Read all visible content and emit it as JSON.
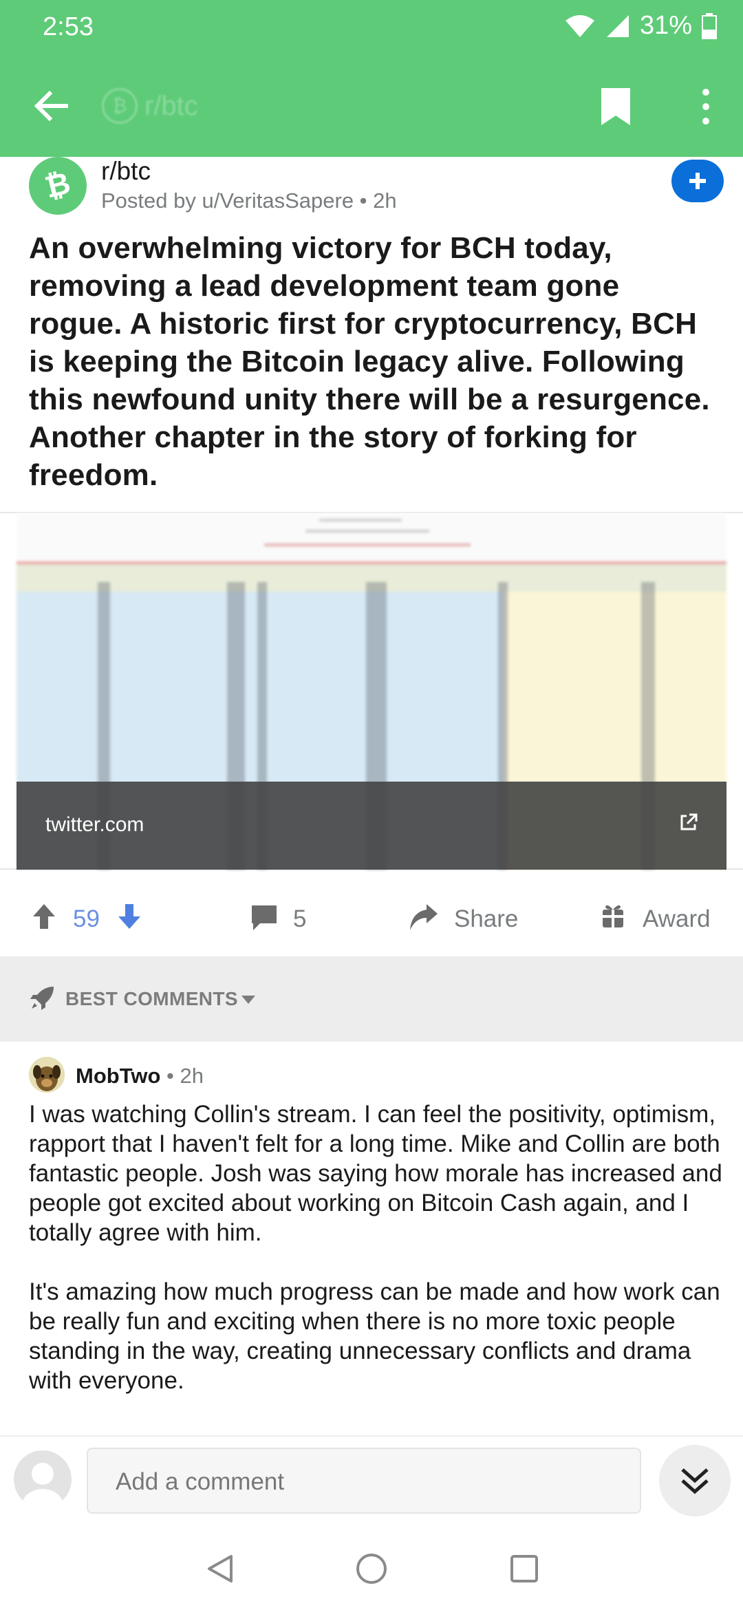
{
  "status_bar": {
    "time": "2:53",
    "battery": "31%"
  },
  "app_bar": {
    "title": "r/btc"
  },
  "post": {
    "subreddit": "r/btc",
    "posted_by": "Posted by u/VeritasSapere • 2h",
    "title": "An overwhelming victory for BCH today, removing a lead development team gone rogue. A historic first for cryptocurrency, BCH is keeping the Bitcoin legacy alive. Following this newfound unity there will be a resurgence. Another chapter in the story of forking for freedom.",
    "link_domain": "twitter.com",
    "score": "59",
    "comments": "5",
    "share_label": "Share",
    "award_label": "Award"
  },
  "sort": {
    "label": "BEST COMMENTS"
  },
  "comment": {
    "author": "MobTwo",
    "meta": "• 2h",
    "paragraphs": [
      "I was watching Collin's stream. I can feel the positivity, optimism, rapport that I haven't felt for a long time. Mike and Collin are both fantastic people. Josh was saying how morale has increased and people got excited about working on Bitcoin Cash again, and I totally agree with him.",
      "It's amazing how much progress can be made and how work can be really fun and exciting when there is no more toxic people standing in the way, creating unnecessary conflicts and drama with everyone."
    ]
  },
  "composer": {
    "placeholder": "Add a comment"
  },
  "colors": {
    "header_green": "#5ecb78",
    "join_blue": "#0a6fd8",
    "upvote_blue": "#6a8fe3"
  },
  "icons": [
    "back-arrow-icon",
    "bitcoin-icon",
    "bookmark-icon",
    "more-vert-icon",
    "plus-icon",
    "external-link-icon",
    "upvote-icon",
    "downvote-icon",
    "comment-icon",
    "share-icon",
    "gift-icon",
    "rocket-icon",
    "caret-down-icon",
    "double-chevron-down-icon"
  ]
}
